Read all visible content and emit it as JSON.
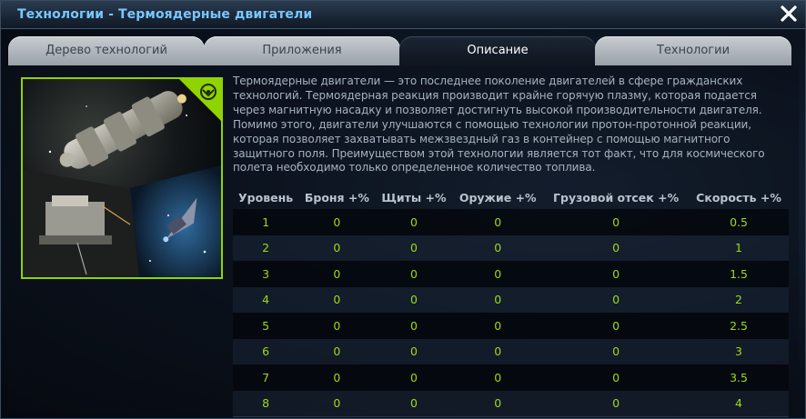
{
  "window": {
    "title": "Технологии - Термоядерные двигатели",
    "close_icon": "close-x-icon"
  },
  "tabs": [
    {
      "label": "Дерево технологий",
      "active": false
    },
    {
      "label": "Приложения",
      "active": false
    },
    {
      "label": "Описание",
      "active": true
    },
    {
      "label": "Технологии",
      "active": false
    }
  ],
  "image": {
    "description_icon": "spaceship-illustration",
    "badge_icon": "faction-emblem-icon",
    "frame_color": "#8fd400"
  },
  "description": "Термоядерные двигатели — это последнее поколение двигателей в сфере гражданских технологий. Термоядерная реакция производит крайне горячую плазму, которая подается через магнитную насадку и позволяет достигнуть высокой производительности двигателя. Помимо этого, двигатели улучшаются с помощью технологии протон-протонной реакции, которая позволяет захватывать межзвездный газ в контейнер с помощью магнитного защитного поля. Преимуществом этой технологии является тот факт, что для космического полета необходимо только определенное количество топлива.",
  "table": {
    "headers": [
      "Уровень",
      "Броня +%",
      "Щиты +%",
      "Оружие +%",
      "Грузовой отсек +%",
      "Скорость +%"
    ],
    "rows": [
      [
        "1",
        "0",
        "0",
        "0",
        "0",
        "0.5"
      ],
      [
        "2",
        "0",
        "0",
        "0",
        "0",
        "1"
      ],
      [
        "3",
        "0",
        "0",
        "0",
        "0",
        "1.5"
      ],
      [
        "4",
        "0",
        "0",
        "0",
        "0",
        "2"
      ],
      [
        "5",
        "0",
        "0",
        "0",
        "0",
        "2.5"
      ],
      [
        "6",
        "0",
        "0",
        "0",
        "0",
        "3"
      ],
      [
        "7",
        "0",
        "0",
        "0",
        "0",
        "3.5"
      ],
      [
        "8",
        "0",
        "0",
        "0",
        "0",
        "4"
      ]
    ],
    "value_color": "#9fd81b"
  }
}
